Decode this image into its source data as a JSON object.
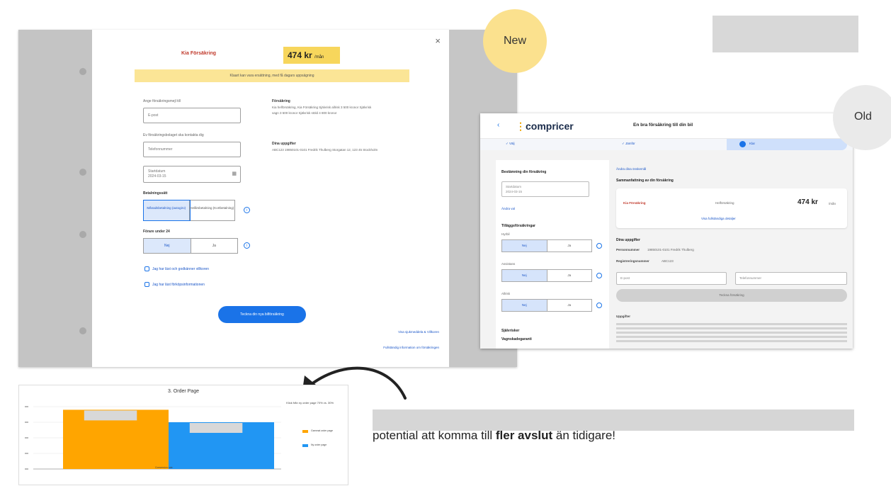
{
  "badges": {
    "new": "New",
    "old": "Old"
  },
  "new_modal": {
    "close": "×",
    "brand": "Kia Försäkring",
    "price": "474 kr",
    "price_unit": "/mån",
    "banner": "Klaart kan vara ersättning, med få dagars uppsägning",
    "email_label": "Ange försäkringsmejl till",
    "email_placeholder": "E-post",
    "phone_label": "Ev försäkringsbolaget ska kontakta dig",
    "phone_placeholder": "Telefonnummer",
    "date_label": "Startdatum",
    "date_value": "2024-03-15",
    "payment_heading": "Betalningssätt",
    "payment_options": [
      "Månadsbetalning (autogiro)",
      "Helårsbetalning (Kortbetalning)"
    ],
    "driver_heading": "Förare under 24",
    "driver_options": [
      "Nej",
      "Ja"
    ],
    "check1": "Jag har läst och godkänner villkoren",
    "check2": "Jag har läst förköpsinformationen",
    "cta": "Teckna din nya bilförsäkring",
    "link1": "Visa sjukmeddela & Villkoren",
    "link2": "Fullständig information om försäkringen",
    "side_heading1": "Försäkring",
    "side_text1": "Kia helförsäkring, Kia Försäkring Självrisk allrisk 3 500 kronor Självrisk vagn 3 500 kronor Självrisk stöld 4 800 kronor",
    "side_heading2": "Dina uppgifter",
    "side_text2": "ABC123 19850101-0101 Fredrik Thulberg Storgatan 12, 123 45 Stockholm"
  },
  "old_page": {
    "back": "‹",
    "logo_main": "compricer",
    "logo_accent": "⋮",
    "title": "En bra försäkring till din bil",
    "steps": [
      "Välj",
      "Jämför",
      "Klar"
    ],
    "left": {
      "heading": "Bestämning din försäkring",
      "date_label": "Startdatum",
      "date_value": "2024-03-15",
      "link_more": "Ändra val",
      "addons_heading": "Tilläggsförsäkringar",
      "addon1": "Hyrbil",
      "addon2": "Assistans",
      "addon3": "Allrisk",
      "yes": "Nej",
      "no": "Ja",
      "bottom1": "Självrisker",
      "bottom2": "Vagnskadegaranti"
    },
    "right": {
      "change_link": "Ändra dina önskemål",
      "summary_heading": "Sammanfattning av din försäkring",
      "brand": "Kia Försäkring",
      "plan": "Helförsäkring",
      "price": "474 kr",
      "price_unit": "/mån",
      "see_details": "Visa fullständiga detaljer",
      "your_details": "Dina uppgifter",
      "personal_label": "Personnummer",
      "personal_value": "19850101-0101 Fredrik Thulberg",
      "reg_label": "Registreringsnummer",
      "reg_value": "ABC123",
      "email_placeholder": "E-post",
      "phone_placeholder": "Telefonnummer",
      "submit": "Teckna försäkring",
      "footer_heading": "Uppgifter"
    }
  },
  "chart_data": {
    "type": "bar",
    "title": "3. Order Page",
    "subtitle": "Klick från ny order page 70% vs. 30%",
    "categories": [
      "Conversion rate"
    ],
    "series": [
      {
        "name": "Gammal order page",
        "color": "#FFA500",
        "values": [
          38
        ]
      },
      {
        "name": "Ny order page",
        "color": "#2196F3",
        "values": [
          30
        ]
      }
    ],
    "ylim": [
      0,
      40
    ],
    "grid": true,
    "legend": "right"
  },
  "tagline": {
    "prefix": "potential att komma till ",
    "bold": "fler avslut",
    "suffix": " än tidigare!"
  }
}
